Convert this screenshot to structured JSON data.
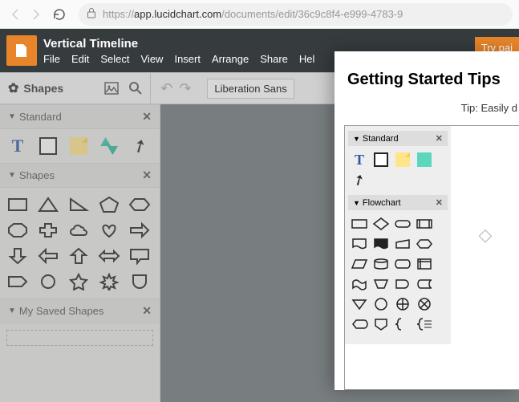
{
  "browser": {
    "url_domain": "app.lucidchart.com",
    "url_path": "/documents/edit/36c9c8f4-e999-4783-9"
  },
  "header": {
    "doc_title": "Vertical Timeline",
    "menu": [
      "File",
      "Edit",
      "Select",
      "View",
      "Insert",
      "Arrange",
      "Share",
      "Hel"
    ],
    "try_paid": "Try pai"
  },
  "toolbar": {
    "shapes_label": "Shapes",
    "font_value": "Liberation Sans"
  },
  "sidebar": {
    "standard_label": "Standard",
    "shapes_label": "Shapes",
    "saved_label": "My Saved Shapes"
  },
  "tips": {
    "title": "Getting Started Tips",
    "sub": "Tip: Easily d",
    "standard_label": "Standard",
    "flowchart_label": "Flowchart"
  }
}
